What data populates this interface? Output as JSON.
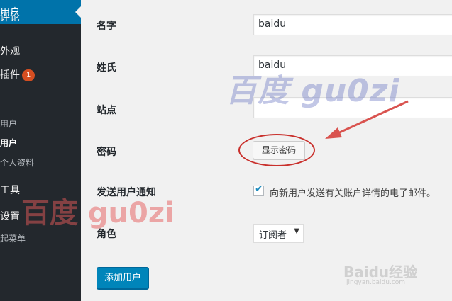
{
  "sidebar": {
    "comments_label": "评论",
    "appearance_label": "外观",
    "plugins_label": "插件",
    "plugins_badge": "1",
    "users_label": "用户",
    "all_users_label": "用户",
    "add_user_label": "用户",
    "profile_label": "个人资料",
    "tools_label": "工具",
    "settings_label": "设置",
    "collapse_label": "起菜单"
  },
  "form": {
    "name_label": "名字",
    "name_value": "baidu",
    "last_name_label": "姓氏",
    "last_name_value": "baidu",
    "website_label": "站点",
    "website_value": "",
    "password_label": "密码",
    "show_password_button": "显示密码",
    "notify_label": "发送用户通知",
    "notify_checked": true,
    "notify_text": "向新用户发送有关账户详情的电子邮件。",
    "role_label": "角色",
    "role_value": "订阅者",
    "submit_button": "添加用户"
  },
  "watermarks": {
    "top": "百度 gu0zi",
    "left": "百度 gu0zi",
    "logo": "Baidu经验",
    "logo_sub": "jingyan.baidu.com"
  },
  "colors": {
    "sidebar_bg": "#23282d",
    "active_menu_bg": "#0073aa",
    "primary_button": "#0085ba",
    "badge": "#d54e21",
    "annotation_red": "#c9302c"
  }
}
